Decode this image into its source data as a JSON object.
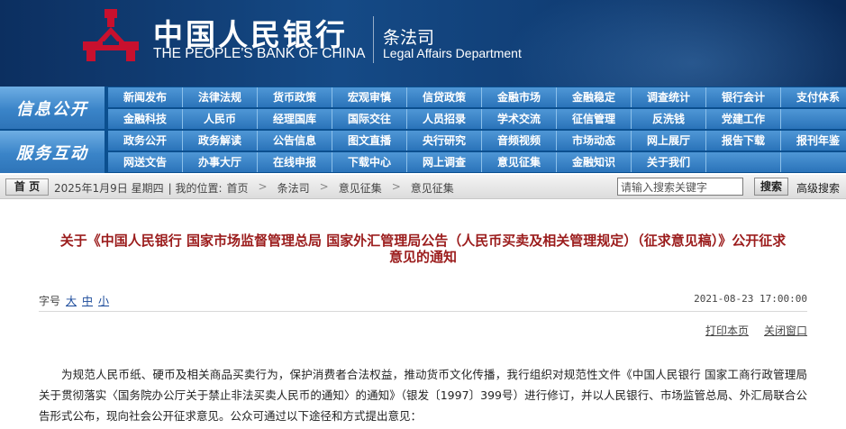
{
  "header": {
    "bank_name_cn": "中国人民银行",
    "bank_name_en": "THE PEOPLE'S BANK OF CHINA",
    "dept_cn": "条法司",
    "dept_en": "Legal Affairs Department",
    "logo_icon": "pboc-emblem-icon",
    "logo_color": "#c8102e"
  },
  "nav": {
    "label_1": "信息公开",
    "label_2": "服务互动",
    "row_1": [
      "新闻发布",
      "法律法规",
      "货币政策",
      "宏观审慎",
      "信贷政策",
      "金融市场",
      "金融稳定",
      "调查统计",
      "银行会计",
      "支付体系"
    ],
    "row_2": [
      "金融科技",
      "人民币",
      "经理国库",
      "国际交往",
      "人员招录",
      "学术交流",
      "征信管理",
      "反洗钱",
      "党建工作",
      ""
    ],
    "row_3": [
      "政务公开",
      "政务解读",
      "公告信息",
      "图文直播",
      "央行研究",
      "音频视频",
      "市场动态",
      "网上展厅",
      "报告下载",
      "报刊年鉴"
    ],
    "row_4": [
      "网送文告",
      "办事大厅",
      "在线申报",
      "下载中心",
      "网上调查",
      "意见征集",
      "金融知识",
      "关于我们",
      "",
      ""
    ]
  },
  "location_bar": {
    "home_label": "首 页",
    "date_text": "2025年1月9日 星期四",
    "location_prefix": "|  我的位置:",
    "crumb_1": "首页",
    "crumb_2": "条法司",
    "crumb_3": "意见征集",
    "crumb_4": "意见征集",
    "crumb_sep": ">",
    "search_placeholder": "请输入搜索关键字",
    "search_button": "搜索",
    "advanced_search": "高级搜索"
  },
  "article": {
    "title_line_1": "关于《中国人民银行 国家市场监督管理总局 国家外汇管理局公告（人民币买卖及相关管理规定）（征求意见稿）》公开征求",
    "title_line_2": "意见的通知",
    "font_size_label": "字号",
    "font_size_large": "大",
    "font_size_medium": "中",
    "font_size_small": "小",
    "pub_date": "2021-08-23 17:00:00",
    "print_label": "打印本页",
    "close_label": "关闭窗口",
    "body": "为规范人民币纸、硬币及相关商品买卖行为，保护消费者合法权益，推动货币文化传播，我行组织对规范性文件《中国人民银行 国家工商行政管理局关于贯彻落实〈国务院办公厅关于禁止非法买卖人民币的通知〉的通知》（银发〔1997〕399号）进行修订，并以人民银行、市场监管总局、外汇局联合公告形式公布，现向社会公开征求意见。公众可通过以下途径和方式提出意见："
  },
  "colors": {
    "banner_dark": "#0c2f60",
    "nav_bg": "#0b4f8f",
    "nav_item": "#2a73b9",
    "title_red": "#9b1c1c"
  }
}
